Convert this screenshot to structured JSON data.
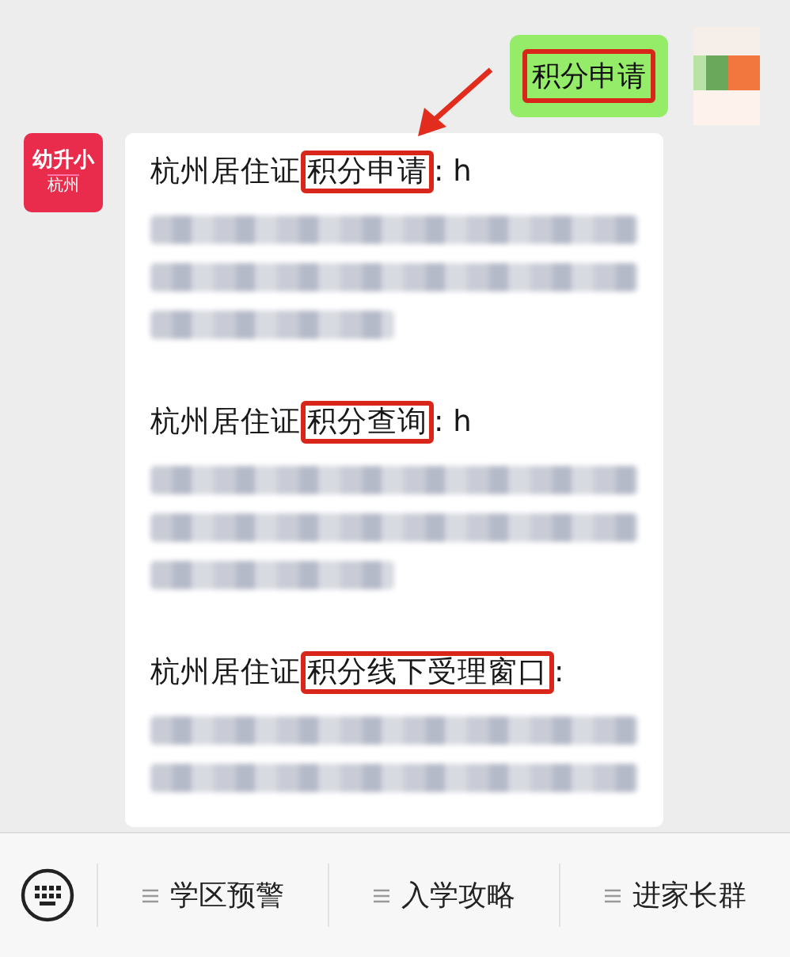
{
  "outgoing_message": {
    "text": "积分申请",
    "highlighted": true
  },
  "incoming_message": {
    "sender_avatar": {
      "title": "幼升小",
      "subtitle": "杭州"
    },
    "sections": [
      {
        "prefix": "杭州居住证",
        "highlight": "积分申请",
        "suffix": ": h",
        "redacted_lines": [
          {
            "kind": "long"
          },
          {
            "kind": "long"
          },
          {
            "kind": "short"
          }
        ]
      },
      {
        "prefix": "杭州居住证",
        "highlight": "积分查询",
        "suffix": ": h",
        "redacted_lines": [
          {
            "kind": "long"
          },
          {
            "kind": "long"
          },
          {
            "kind": "short"
          }
        ]
      },
      {
        "prefix": "杭州居住证",
        "highlight": "积分线下受理窗口",
        "suffix": ":",
        "redacted_lines": [
          {
            "kind": "long"
          },
          {
            "kind": "long"
          }
        ]
      }
    ]
  },
  "menu_bar": {
    "items": [
      {
        "label": "学区预警"
      },
      {
        "label": "入学攻略"
      },
      {
        "label": "进家长群"
      }
    ]
  }
}
